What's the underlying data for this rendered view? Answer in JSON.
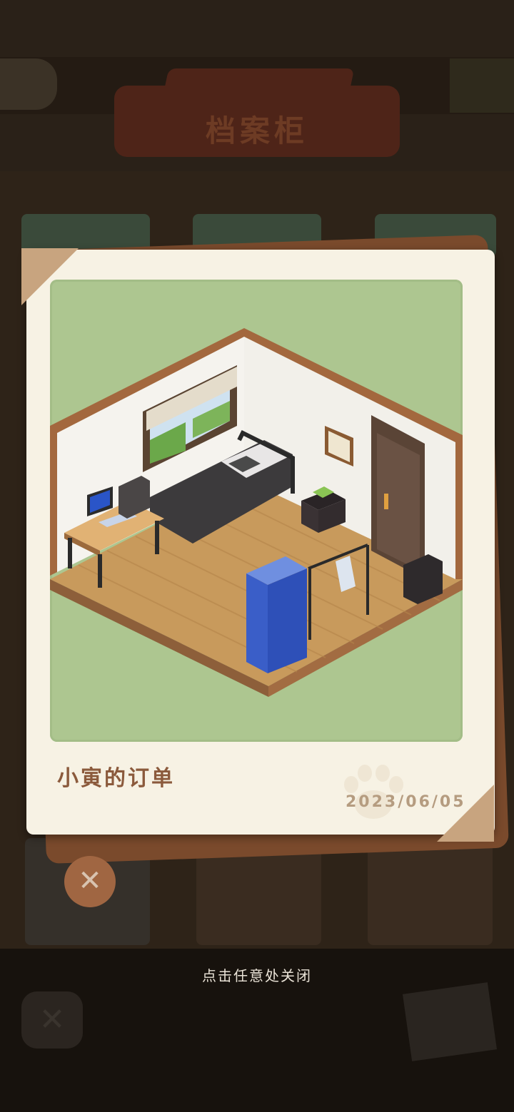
{
  "background": {
    "title": "档案柜"
  },
  "popup": {
    "caption": "小寅的订单",
    "date": "2023/06/05",
    "close_hint": "点击任意处关闭"
  },
  "icons": {
    "close_badge": "close-icon",
    "bottom_close": "close-icon",
    "paw": "paw-icon"
  },
  "colors": {
    "card": "#f7f2e4",
    "photo_bg": "#adc690",
    "caption": "#8b5a3c",
    "accent_corner": "#c8a47f"
  }
}
